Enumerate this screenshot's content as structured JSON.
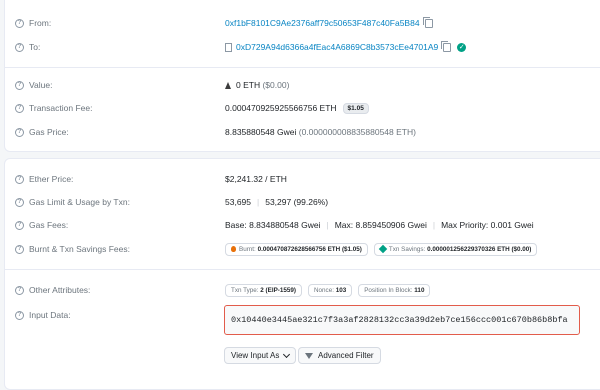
{
  "card1": {
    "from": {
      "label": "From:",
      "address": "0xf1bF8101C9Ae2376aff79c50653F487c40Fa5B84"
    },
    "to": {
      "label": "To:",
      "address": "0xD729A94d6366a4fEac4A6869C8b3573cEe4701A9"
    },
    "value": {
      "label": "Value:",
      "amount": "0 ETH",
      "usd": "($0.00)"
    },
    "fee": {
      "label": "Transaction Fee:",
      "amount": "0.000470925925566756 ETH",
      "usd": "$1.05"
    },
    "gas_price": {
      "label": "Gas Price:",
      "amount": "8.835880548 Gwei",
      "eth": "(0.000000008835880548 ETH)"
    }
  },
  "card2": {
    "ether_price": {
      "label": "Ether Price:",
      "value": "$2,241.32 / ETH"
    },
    "gas_limit": {
      "label": "Gas Limit & Usage by Txn:",
      "limit": "53,695",
      "usage": "53,297 (99.26%)"
    },
    "gas_fees": {
      "label": "Gas Fees:",
      "base": "Base: 8.834880548 Gwei",
      "max": "Max: 8.859450906 Gwei",
      "priority": "Max Priority: 0.001 Gwei"
    },
    "burnt": {
      "label": "Burnt & Txn Savings Fees:",
      "burnt_label": "Burnt:",
      "burnt_value": "0.000470872628566756 ETH ($1.05)",
      "savings_label": "Txn Savings:",
      "savings_value": "0.000001256229370326 ETH ($0.00)"
    },
    "other": {
      "label": "Other Attributes:",
      "txn_type_label": "Txn Type:",
      "txn_type_value": "2 (EIP-1559)",
      "nonce_label": "Nonce:",
      "nonce_value": "103",
      "position_label": "Position In Block:",
      "position_value": "110"
    },
    "input": {
      "label": "Input Data:",
      "data": "0x10440e3445ae321c7f3a3af2828132cc3a39d2eb7ce156ccc001c670b86b8bfa"
    },
    "buttons": {
      "view_input": "View Input As",
      "advanced_filter": "Advanced Filter"
    }
  }
}
